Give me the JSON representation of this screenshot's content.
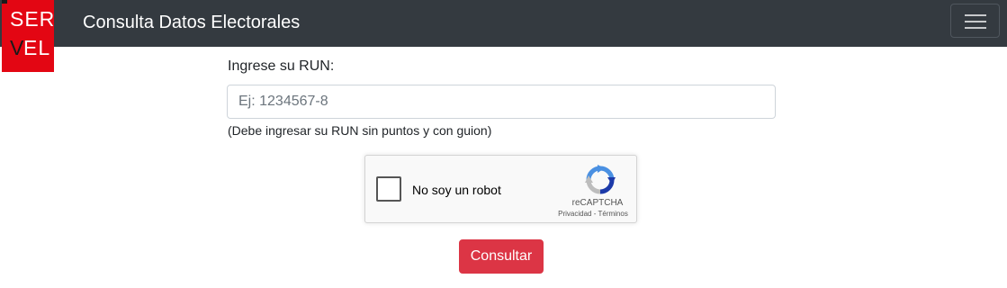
{
  "header": {
    "logo_line1": "SER",
    "logo_v": "V",
    "logo_el": "EL",
    "title": "Consulta Datos Electorales",
    "menu_icon": "hamburger-menu-icon"
  },
  "form": {
    "run_label": "Ingrese su RUN:",
    "run_placeholder": "Ej: 1234567-8",
    "run_value": "",
    "help_text": "(Debe ingresar su RUN sin puntos y con guion)",
    "submit_label": "Consultar"
  },
  "recaptcha": {
    "label": "No soy un robot",
    "brand": "reCAPTCHA",
    "privacy": "Privacidad",
    "separator": " - ",
    "terms": "Términos",
    "icon": "recaptcha-logo-icon"
  },
  "colors": {
    "navbar": "#343a40",
    "logo": "#e30613",
    "submit": "#dc3545"
  }
}
